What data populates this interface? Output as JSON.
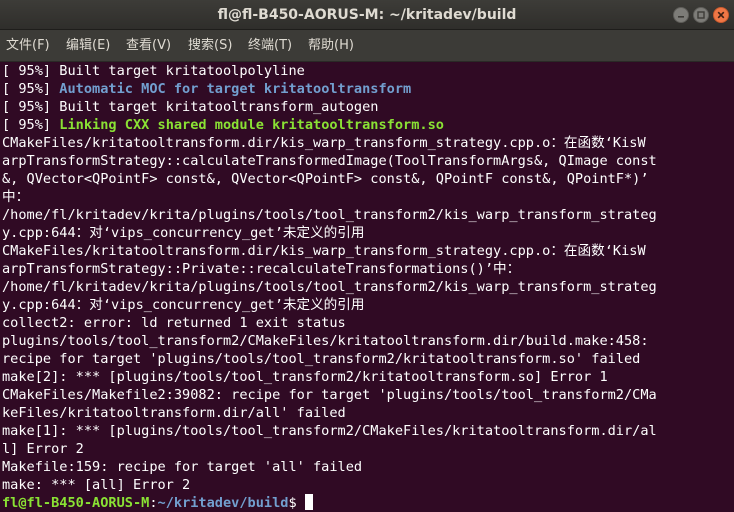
{
  "window": {
    "title": "fl@fl-B450-AORUS-M: ~/kritadev/build",
    "min_icon": "minimize-icon",
    "max_icon": "maximize-icon",
    "close_icon": "close-icon"
  },
  "menu": {
    "items": [
      "文件(F)",
      "编辑(E)",
      "查看(V)",
      "搜索(S)",
      "终端(T)",
      "帮助(H)"
    ]
  },
  "colors": {
    "background": "#300a24",
    "text": "#ffffff",
    "blue": "#729fcf",
    "green": "#8ae234",
    "titlebar": "#3c3b37"
  },
  "terminal": {
    "lines": [
      {
        "text": "[ 95%] Built target kritatoolpolyline"
      },
      {
        "prefix": "[ 95%] ",
        "colored": "Automatic MOC for target kritatooltransform",
        "style": "blue"
      },
      {
        "text": "[ 95%] Built target kritatooltransform_autogen"
      },
      {
        "prefix": "[ 95%] ",
        "colored": "Linking CXX shared module kritatooltransform.so",
        "style": "green"
      },
      {
        "text": "CMakeFiles/kritatooltransform.dir/kis_warp_transform_strategy.cpp.o：在函数‘KisW"
      },
      {
        "text": "arpTransformStrategy::calculateTransformedImage(ToolTransformArgs&, QImage const"
      },
      {
        "text": "&, QVector<QPointF> const&, QVector<QPointF> const&, QPointF const&, QPointF*)’"
      },
      {
        "text": "中："
      },
      {
        "text": "/home/fl/kritadev/krita/plugins/tools/tool_transform2/kis_warp_transform_strateg"
      },
      {
        "text": "y.cpp:644：对‘vips_concurrency_get’未定义的引用"
      },
      {
        "text": "CMakeFiles/kritatooltransform.dir/kis_warp_transform_strategy.cpp.o：在函数‘KisW"
      },
      {
        "text": "arpTransformStrategy::Private::recalculateTransformations()’中："
      },
      {
        "text": "/home/fl/kritadev/krita/plugins/tools/tool_transform2/kis_warp_transform_strateg"
      },
      {
        "text": "y.cpp:644：对‘vips_concurrency_get’未定义的引用"
      },
      {
        "text": "collect2: error: ld returned 1 exit status"
      },
      {
        "text": "plugins/tools/tool_transform2/CMakeFiles/kritatooltransform.dir/build.make:458:"
      },
      {
        "text": "recipe for target 'plugins/tools/tool_transform2/kritatooltransform.so' failed"
      },
      {
        "text": "make[2]: *** [plugins/tools/tool_transform2/kritatooltransform.so] Error 1"
      },
      {
        "text": "CMakeFiles/Makefile2:39082: recipe for target 'plugins/tools/tool_transform2/CMa"
      },
      {
        "text": "keFiles/kritatooltransform.dir/all' failed"
      },
      {
        "text": "make[1]: *** [plugins/tools/tool_transform2/CMakeFiles/kritatooltransform.dir/al"
      },
      {
        "text": "l] Error 2"
      },
      {
        "text": "Makefile:159: recipe for target 'all' failed"
      },
      {
        "text": "make: *** [all] Error 2"
      }
    ],
    "prompt": {
      "user_host": "fl@fl-B450-AORUS-M",
      "separator": ":",
      "path": "~/kritadev/build",
      "symbol": "$"
    }
  }
}
